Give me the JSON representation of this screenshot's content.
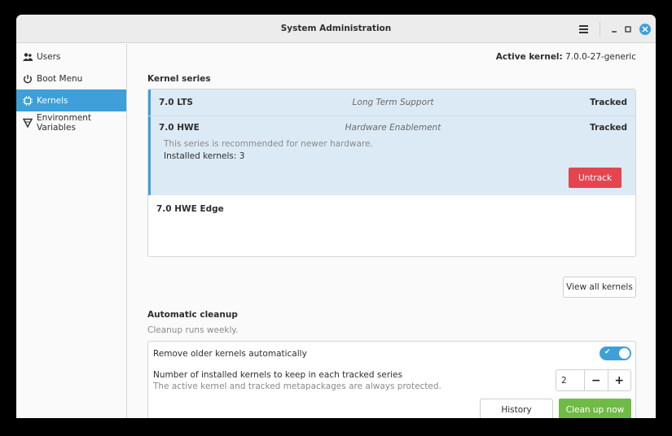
{
  "window": {
    "title": "System Administration"
  },
  "sidebar": {
    "items": [
      {
        "label": "Users",
        "icon": "users-icon",
        "active": false
      },
      {
        "label": "Boot Menu",
        "icon": "power-icon",
        "active": false
      },
      {
        "label": "Kernels",
        "icon": "chip-icon",
        "active": true
      },
      {
        "label": "Environment Variables",
        "icon": "triangle-icon",
        "active": false
      }
    ]
  },
  "header": {
    "active_kernel_label": "Active kernel:",
    "active_kernel_value": "7.0.0-27-generic"
  },
  "kernel_series": {
    "heading": "Kernel series",
    "rows": [
      {
        "name": "7.0 LTS",
        "description": "Long Term Support",
        "status": "Tracked"
      },
      {
        "name": "7.0 HWE",
        "description": "Hardware Enablement",
        "status": "Tracked",
        "detail_note": "This series is recommended for newer hardware.",
        "installed": "Installed kernels: 3",
        "action": "Untrack"
      },
      {
        "name": "7.0 HWE Edge",
        "description": "",
        "status": ""
      }
    ],
    "view_all_label": "View all kernels"
  },
  "cleanup": {
    "heading": "Automatic cleanup",
    "subtitle": "Cleanup runs weekly.",
    "auto_remove_label": "Remove older kernels automatically",
    "auto_remove_enabled": true,
    "keep_label": "Number of installed kernels to keep in each tracked series",
    "keep_note": "The active kernel and tracked metapackages are always protected.",
    "keep_value": "2",
    "minus": "−",
    "plus": "+",
    "history_label": "History",
    "cleanup_label": "Clean up now"
  },
  "colors": {
    "accent": "#3e9fd9",
    "danger": "#e4454f",
    "success": "#6fbb45"
  }
}
